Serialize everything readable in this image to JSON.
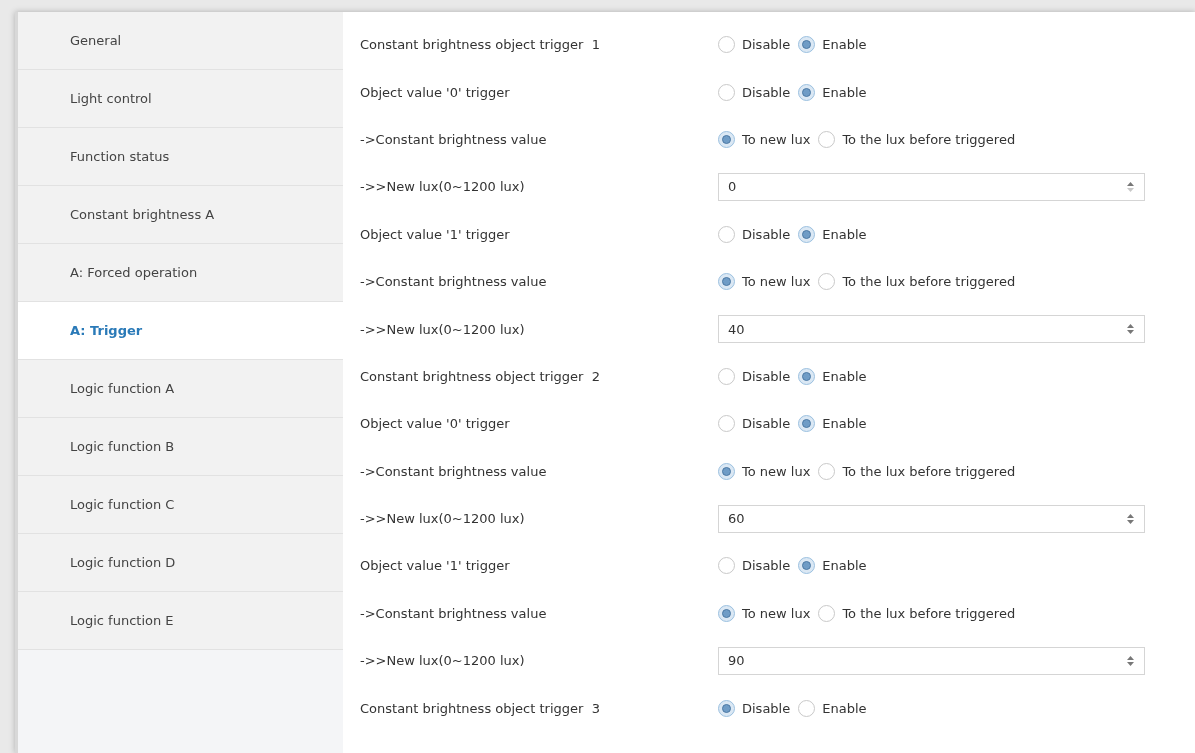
{
  "sidebar": {
    "items": [
      {
        "label": "General",
        "selected": false
      },
      {
        "label": "Light control",
        "selected": false
      },
      {
        "label": "Function status",
        "selected": false
      },
      {
        "label": "Constant brightness A",
        "selected": false
      },
      {
        "label": "A: Forced operation",
        "selected": false
      },
      {
        "label": "A: Trigger",
        "selected": true
      },
      {
        "label": "Logic function A",
        "selected": false
      },
      {
        "label": "Logic function B",
        "selected": false
      },
      {
        "label": "Logic function C",
        "selected": false
      },
      {
        "label": "Logic function D",
        "selected": false
      },
      {
        "label": "Logic function E",
        "selected": false
      }
    ]
  },
  "parameters": [
    {
      "kind": "radio",
      "label": "Constant brightness object trigger  1",
      "options": [
        {
          "label": "Disable",
          "selected": false
        },
        {
          "label": "Enable",
          "selected": true
        }
      ]
    },
    {
      "kind": "radio",
      "label": "Object value '0' trigger",
      "options": [
        {
          "label": "Disable",
          "selected": false
        },
        {
          "label": "Enable",
          "selected": true
        }
      ]
    },
    {
      "kind": "radio",
      "label": "->Constant brightness value",
      "options": [
        {
          "label": "To new lux",
          "selected": true
        },
        {
          "label": "To the lux before triggered",
          "selected": false
        }
      ]
    },
    {
      "kind": "spin",
      "label": "->>New lux(0~1200 lux)",
      "value": "0",
      "at_minimum": true
    },
    {
      "kind": "radio",
      "label": "Object value '1' trigger",
      "options": [
        {
          "label": "Disable",
          "selected": false
        },
        {
          "label": "Enable",
          "selected": true
        }
      ]
    },
    {
      "kind": "radio",
      "label": "->Constant brightness value",
      "options": [
        {
          "label": "To new lux",
          "selected": true
        },
        {
          "label": "To the lux before triggered",
          "selected": false
        }
      ]
    },
    {
      "kind": "spin",
      "label": "->>New lux(0~1200 lux)",
      "value": "40",
      "at_minimum": false
    },
    {
      "kind": "radio",
      "label": "Constant brightness object trigger  2",
      "options": [
        {
          "label": "Disable",
          "selected": false
        },
        {
          "label": "Enable",
          "selected": true
        }
      ]
    },
    {
      "kind": "radio",
      "label": "Object value '0' trigger",
      "options": [
        {
          "label": "Disable",
          "selected": false
        },
        {
          "label": "Enable",
          "selected": true
        }
      ]
    },
    {
      "kind": "radio",
      "label": "->Constant brightness value",
      "options": [
        {
          "label": "To new lux",
          "selected": true
        },
        {
          "label": "To the lux before triggered",
          "selected": false
        }
      ]
    },
    {
      "kind": "spin",
      "label": "->>New lux(0~1200 lux)",
      "value": "60",
      "at_minimum": false
    },
    {
      "kind": "radio",
      "label": "Object value '1' trigger",
      "options": [
        {
          "label": "Disable",
          "selected": false
        },
        {
          "label": "Enable",
          "selected": true
        }
      ]
    },
    {
      "kind": "radio",
      "label": "->Constant brightness value",
      "options": [
        {
          "label": "To new lux",
          "selected": true
        },
        {
          "label": "To the lux before triggered",
          "selected": false
        }
      ]
    },
    {
      "kind": "spin",
      "label": "->>New lux(0~1200 lux)",
      "value": "90",
      "at_minimum": false
    },
    {
      "kind": "radio",
      "label": "Constant brightness object trigger  3",
      "options": [
        {
          "label": "Disable",
          "selected": true
        },
        {
          "label": "Enable",
          "selected": false
        }
      ]
    }
  ]
}
